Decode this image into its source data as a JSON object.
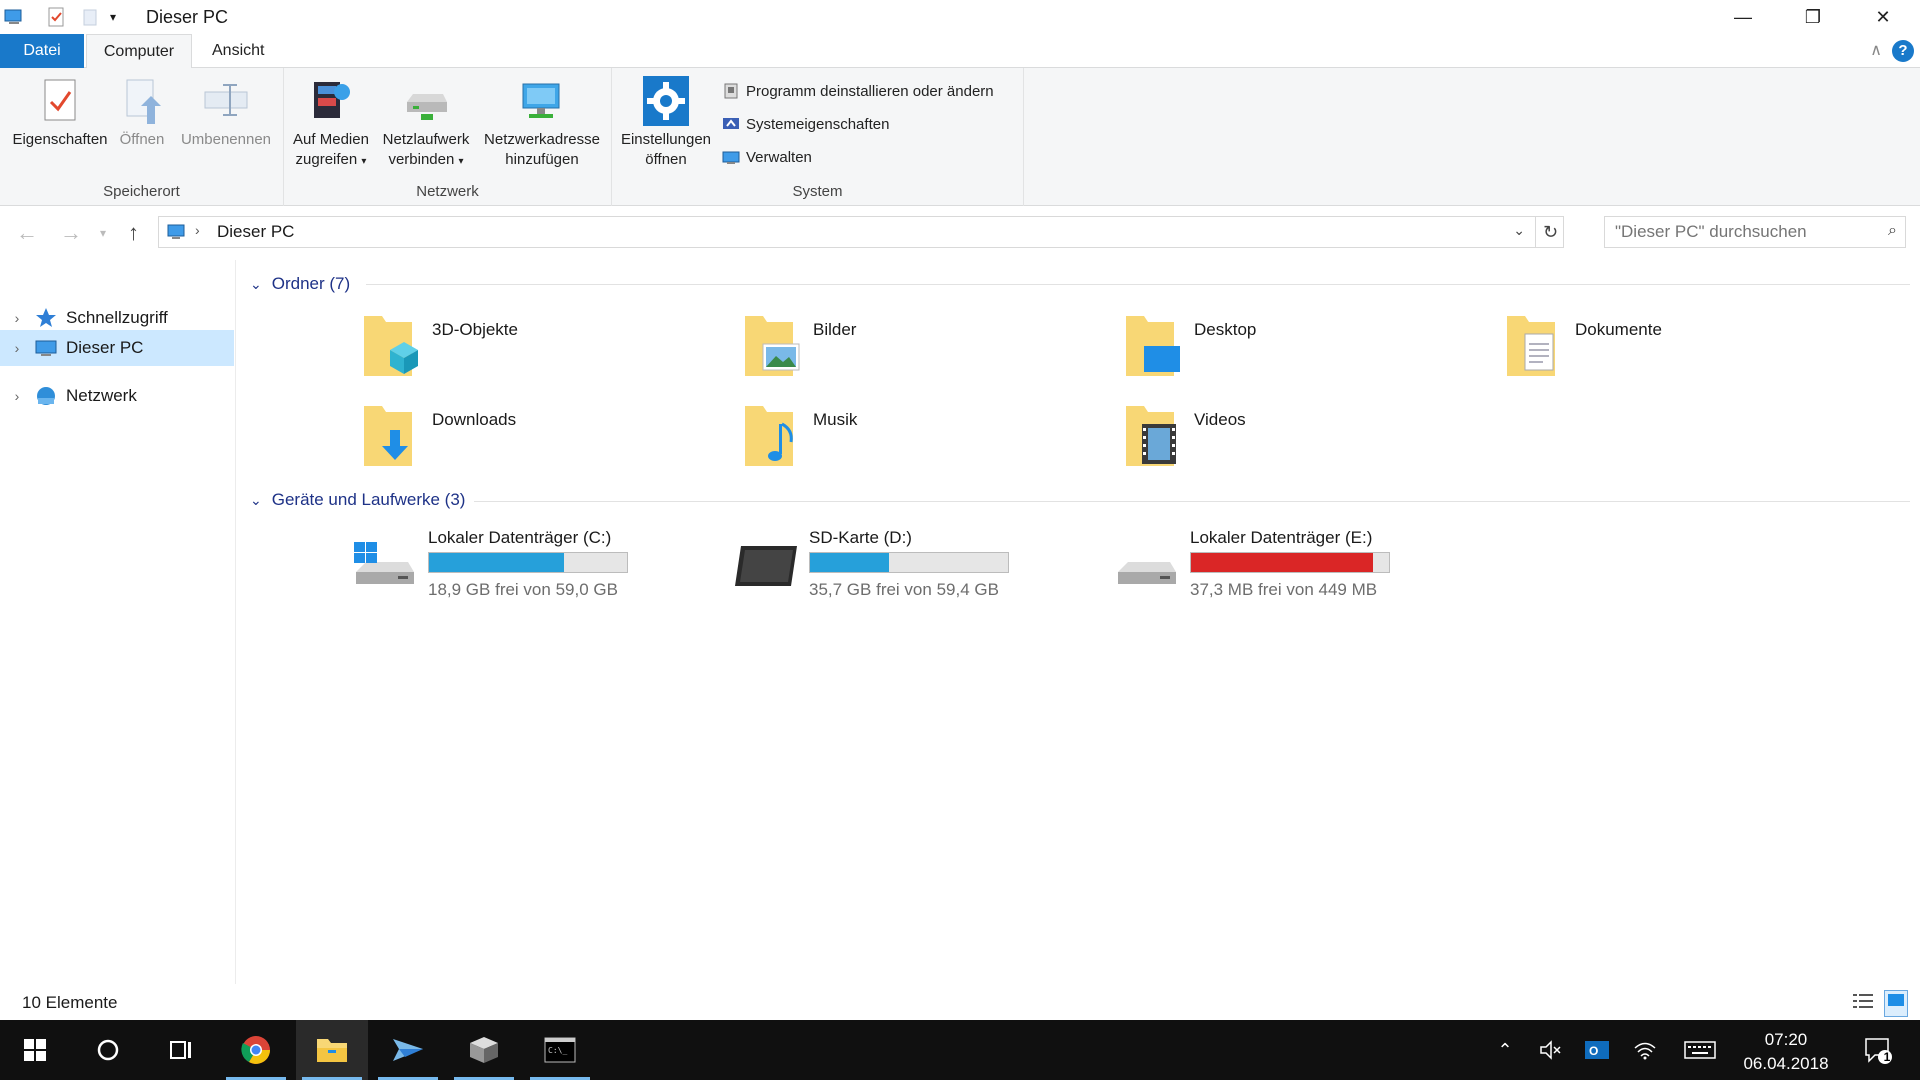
{
  "window": {
    "title": "Dieser PC",
    "minimize": "—",
    "maximize": "❐",
    "close": "✕"
  },
  "ribbon": {
    "tabs": [
      "Datei",
      "Computer",
      "Ansicht"
    ],
    "help": "?",
    "groups": {
      "speicherort": {
        "label": "Speicherort",
        "properties": "Eigenschaften",
        "open": "Öffnen",
        "rename": "Umbenennen"
      },
      "netzwerk": {
        "label": "Netzwerk",
        "media_l1": "Auf Medien",
        "media_l2": "zugreifen",
        "netdrive_l1": "Netzlaufwerk",
        "netdrive_l2": "verbinden",
        "netaddr_l1": "Netzwerkadresse",
        "netaddr_l2": "hinzufügen"
      },
      "system": {
        "label": "System",
        "settings_l1": "Einstellungen",
        "settings_l2": "öffnen",
        "uninstall": "Programm deinstallieren oder ändern",
        "sysprops": "Systemeigenschaften",
        "manage": "Verwalten"
      }
    }
  },
  "address": {
    "path": "Dieser PC",
    "search_placeholder": "\"Dieser PC\" durchsuchen"
  },
  "navpane": {
    "items": [
      {
        "label": "Schnellzugriff"
      },
      {
        "label": "Dieser PC"
      },
      {
        "label": "Netzwerk"
      }
    ]
  },
  "content": {
    "folders_header": "Ordner (7)",
    "folders": [
      {
        "name": "3D-Objekte"
      },
      {
        "name": "Bilder"
      },
      {
        "name": "Desktop"
      },
      {
        "name": "Dokumente"
      },
      {
        "name": "Downloads"
      },
      {
        "name": "Musik"
      },
      {
        "name": "Videos"
      }
    ],
    "drives_header": "Geräte und Laufwerke (3)",
    "drives": [
      {
        "name": "Lokaler Datenträger (C:)",
        "size": "18,9 GB frei von 59,0 GB",
        "used_fraction": 0.68,
        "status_color": "#26a0da"
      },
      {
        "name": "SD-Karte (D:)",
        "size": "35,7 GB frei von 59,4 GB",
        "used_fraction": 0.4,
        "status_color": "#26a0da"
      },
      {
        "name": "Lokaler Datenträger (E:)",
        "size": "37,3 MB frei von 449 MB",
        "used_fraction": 0.92,
        "status_color": "#da2626"
      }
    ]
  },
  "statusbar": {
    "count": "10 Elemente"
  },
  "taskbar": {
    "time": "07:20",
    "date": "06.04.2018",
    "notifications": "1"
  },
  "colors": {
    "accent": "#1979ca",
    "selection": "#cce8ff",
    "group_header": "#1e3287",
    "folder_yellow": "#f8d775",
    "taskbar": "#101010"
  }
}
